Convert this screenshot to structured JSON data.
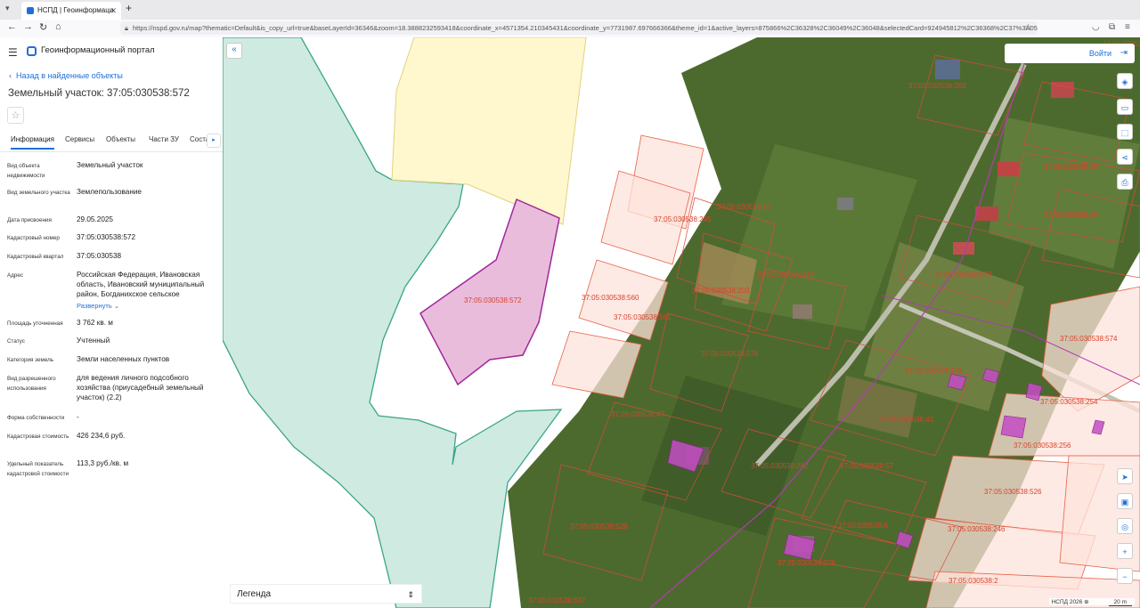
{
  "browser": {
    "tab_title": "НСПД | Геоинформацио",
    "new_tab": "+",
    "url": "https://nspd.gov.ru/map?thematic=Default&is_copy_url=true&baseLayerId=36346&zoom=18.3888232593418&coordinate_x=4571354.210345431&coordinate_y=7731987.697666366&theme_id=1&active_layers=875866%2C36328%2C36049%2C36048&selectedCard=924945812%2C36368%2C37%3A05"
  },
  "header": {
    "brand": "Геоинформационный портал"
  },
  "panel": {
    "back_label": "Назад в найденные объекты",
    "title": "Земельный участок: 37:05:030538:572",
    "tabs": [
      "Информация",
      "Сервисы",
      "Объекты",
      "Части ЗУ",
      "Соста"
    ],
    "expand_label": "Развернуть",
    "fields": [
      {
        "label": "Вид объекта недвижимости",
        "value": "Земельный участок"
      },
      {
        "label": "Вид земельного участка",
        "value": "Землепользование"
      },
      {
        "label": "Дата присвоения",
        "value": "29.05.2025"
      },
      {
        "label": "Кадастровый номер",
        "value": "37:05:030538:572"
      },
      {
        "label": "Кадастровый квартал",
        "value": "37:05:030538"
      },
      {
        "label": "Адрес",
        "value": "Российская Федерация, Ивановская область, Ивановский муниципальный район, Богданихское сельское"
      },
      {
        "label": "Площадь уточненная",
        "value": "3 762 кв. м"
      },
      {
        "label": "Статус",
        "value": "Учтенный"
      },
      {
        "label": "Категория земель",
        "value": "Земли населенных пунктов"
      },
      {
        "label": "Вид разрешенного использования",
        "value": "для ведения личного подсобного хозяйства (приусадебный земельный участок) (2.2)"
      },
      {
        "label": "Форма собственности",
        "value": "-"
      },
      {
        "label": "Кадастровая стоимость",
        "value": "426 234,6 руб."
      },
      {
        "label": "Удельный показатель кадастровой стоимости",
        "value": "113,3 руб./кв. м"
      }
    ]
  },
  "map": {
    "login_label": "Войти",
    "legend_label": "Легенда",
    "attribution": "НСПД 2026 ⊕",
    "scale_label": "20 m",
    "selected_parcel": "37:05:030538:572",
    "parcel_labels": [
      "37:05:030538:263",
      "37:05:030538:34",
      "37:05:030538:285",
      "37:05:030538:284",
      "37:05:030538:203",
      "37:05:030538:560",
      "37:05:030538:561",
      "37:05:030538:576",
      "37:05:030538:573",
      "37:05:030538:48",
      "37:05:030538:49",
      "37:05:030538:574",
      "37:05:030538:249",
      "37:05:030538:43",
      "37:05:030538:254",
      "37:05:030538:256",
      "37:05:030538:47",
      "37:05:030538:282",
      "37:05:030538:57",
      "37:05:030538:526",
      "37:05:030538:528",
      "37:05:030538:4",
      "37:05:030538:246",
      "37:05:030538:278",
      "37:05:030538:2",
      "37:05:030538:537",
      "37:05:030538:235"
    ],
    "colors": {
      "selected_fill": "#e9bcdc",
      "selected_stroke": "#a0289a",
      "parcel_stroke": "#e8614a",
      "water": "#cfeae1",
      "zone": "#fff8cf"
    }
  }
}
